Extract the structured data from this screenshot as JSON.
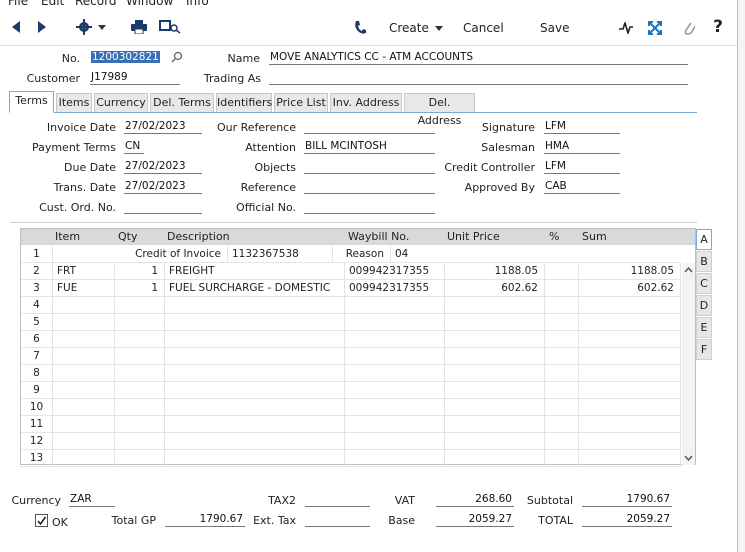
{
  "menubar": [
    "File",
    "Edit",
    "Record",
    "Window",
    "Info"
  ],
  "toolbar": {
    "create_label": "Create",
    "cancel_label": "Cancel",
    "save_label": "Save",
    "help_label": "?"
  },
  "header": {
    "no_label": "No.",
    "no_value": "1200302821",
    "name_label": "Name",
    "name_value": "MOVE ANALYTICS CC - ATM ACCOUNTS",
    "customer_label": "Customer",
    "customer_value": "J17989",
    "trading_as_label": "Trading As",
    "trading_as_value": ""
  },
  "tabs": [
    "Terms",
    "Items",
    "Currency",
    "Del. Terms",
    "Identifiers",
    "Price List",
    "Inv. Address",
    "Del. Address"
  ],
  "terms": {
    "invoice_date_label": "Invoice Date",
    "invoice_date": "27/02/2023",
    "payment_terms_label": "Payment Terms",
    "payment_terms": "CN",
    "due_date_label": "Due Date",
    "due_date": "27/02/2023",
    "trans_date_label": "Trans. Date",
    "trans_date": "27/02/2023",
    "cust_ord_label": "Cust. Ord. No.",
    "cust_ord": "",
    "our_reference_label": "Our Reference",
    "our_reference": "",
    "attention_label": "Attention",
    "attention": "BILL MCINTOSH",
    "objects_label": "Objects",
    "objects": "",
    "reference_label": "Reference",
    "reference": "",
    "official_no_label": "Official No.",
    "official_no": "",
    "signature_label": "Signature",
    "signature": "LFM",
    "salesman_label": "Salesman",
    "salesman": "HMA",
    "credit_controller_label": "Credit Controller",
    "credit_controller": "LFM",
    "approved_by_label": "Approved By",
    "approved_by": "CAB"
  },
  "grid": {
    "columns": [
      "Item",
      "Qty",
      "Description",
      "Waybill No.",
      "Unit Price",
      "%",
      "Sum"
    ],
    "row1": {
      "n": "1",
      "credit_label": "Credit of Invoice",
      "credit_invoice": "1132367538",
      "reason_label": "Reason",
      "reason": "04"
    },
    "rows": [
      {
        "n": "2",
        "item": "FRT",
        "qty": "1",
        "desc": "FREIGHT",
        "waybill": "009942317355",
        "price": "1188.05",
        "pct": "",
        "sum": "1188.05"
      },
      {
        "n": "3",
        "item": "FUE",
        "qty": "1",
        "desc": "FUEL SURCHARGE - DOMESTIC",
        "waybill": "009942317355",
        "price": "602.62",
        "pct": "",
        "sum": "602.62"
      },
      {
        "n": "4"
      },
      {
        "n": "5"
      },
      {
        "n": "6"
      },
      {
        "n": "7"
      },
      {
        "n": "8"
      },
      {
        "n": "9"
      },
      {
        "n": "10"
      },
      {
        "n": "11"
      },
      {
        "n": "12"
      },
      {
        "n": "13"
      }
    ],
    "side_tabs": [
      "A",
      "B",
      "C",
      "D",
      "E",
      "F"
    ]
  },
  "footer": {
    "currency_label": "Currency",
    "currency": "ZAR",
    "ok_label": "OK",
    "total_gp_label": "Total GP",
    "total_gp": "1790.67",
    "tax2_label": "TAX2",
    "tax2": "",
    "ext_tax_label": "Ext. Tax",
    "ext_tax": "",
    "vat_label": "VAT",
    "vat": "268.60",
    "base_label": "Base",
    "base": "2059.27",
    "subtotal_label": "Subtotal",
    "subtotal": "1790.67",
    "total_label": "TOTAL",
    "total": "2059.27"
  },
  "colors": {
    "accent": "#1f77c4",
    "selection": "#3a6fb5",
    "header_bg": "#d9d9d9"
  }
}
